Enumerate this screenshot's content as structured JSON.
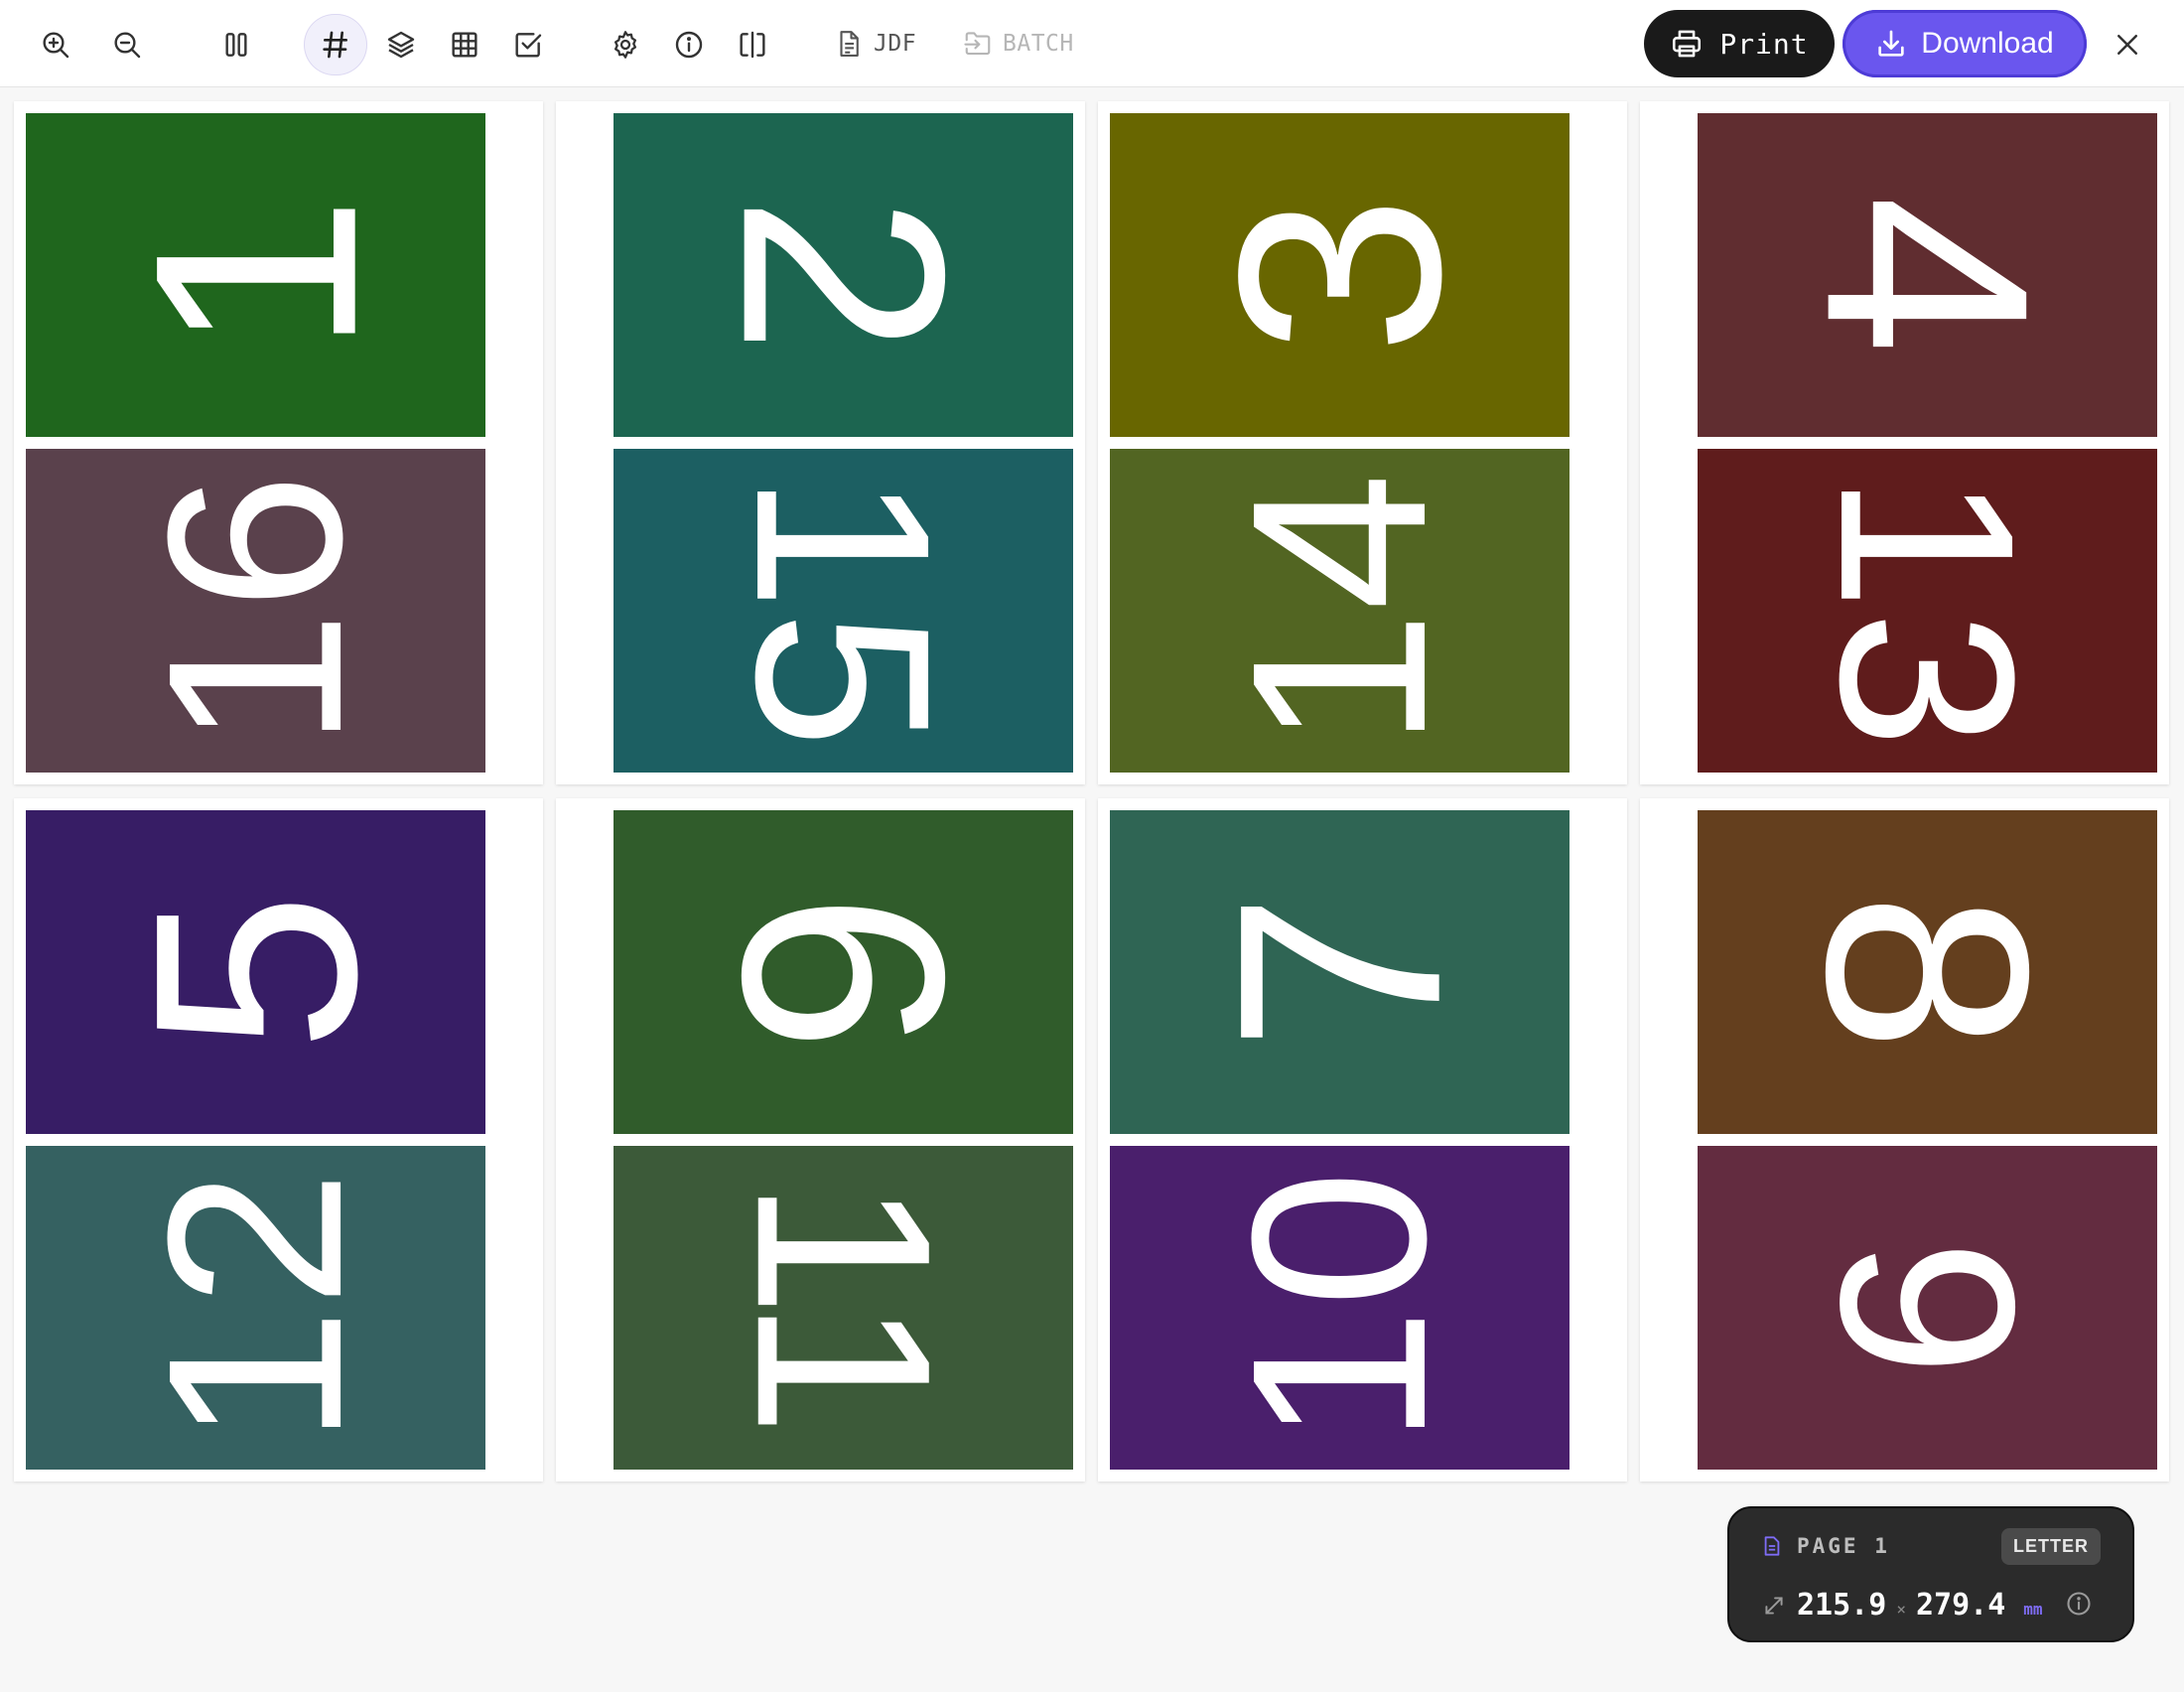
{
  "toolbar": {
    "jdf_label": "JDF",
    "batch_label": "BATCH",
    "print_label": "Print",
    "download_label": "Download"
  },
  "sheets": [
    {
      "panels": [
        {
          "number": "1",
          "color": "#1f661d",
          "orientation": "left"
        },
        {
          "number": "16",
          "color": "#5a414c",
          "orientation": "left"
        }
      ]
    },
    {
      "panels": [
        {
          "number": "2",
          "color": "#1c6550",
          "orientation": "right"
        },
        {
          "number": "15",
          "color": "#1c5f62",
          "orientation": "right"
        }
      ]
    },
    {
      "panels": [
        {
          "number": "3",
          "color": "#686600",
          "orientation": "left"
        },
        {
          "number": "14",
          "color": "#526522",
          "orientation": "left"
        }
      ]
    },
    {
      "panels": [
        {
          "number": "4",
          "color": "#602d30",
          "orientation": "right"
        },
        {
          "number": "13",
          "color": "#5f1c1c",
          "orientation": "right"
        }
      ]
    },
    {
      "panels": [
        {
          "number": "5",
          "color": "#371d65",
          "orientation": "left"
        },
        {
          "number": "12",
          "color": "#356161",
          "orientation": "left"
        }
      ]
    },
    {
      "panels": [
        {
          "number": "6",
          "color": "#305c2b",
          "orientation": "right"
        },
        {
          "number": "11",
          "color": "#3c5a39",
          "orientation": "right"
        }
      ]
    },
    {
      "panels": [
        {
          "number": "7",
          "color": "#2f6554",
          "orientation": "left"
        },
        {
          "number": "10",
          "color": "#4a1f6c",
          "orientation": "left"
        }
      ]
    },
    {
      "panels": [
        {
          "number": "8",
          "color": "#643f1e",
          "orientation": "right"
        },
        {
          "number": "9",
          "color": "#632c40",
          "orientation": "right"
        }
      ]
    }
  ],
  "page_info": {
    "label": "PAGE 1",
    "format": "LETTER",
    "width": "215.9",
    "separator": "×",
    "height": "279.4",
    "unit": "mm"
  }
}
